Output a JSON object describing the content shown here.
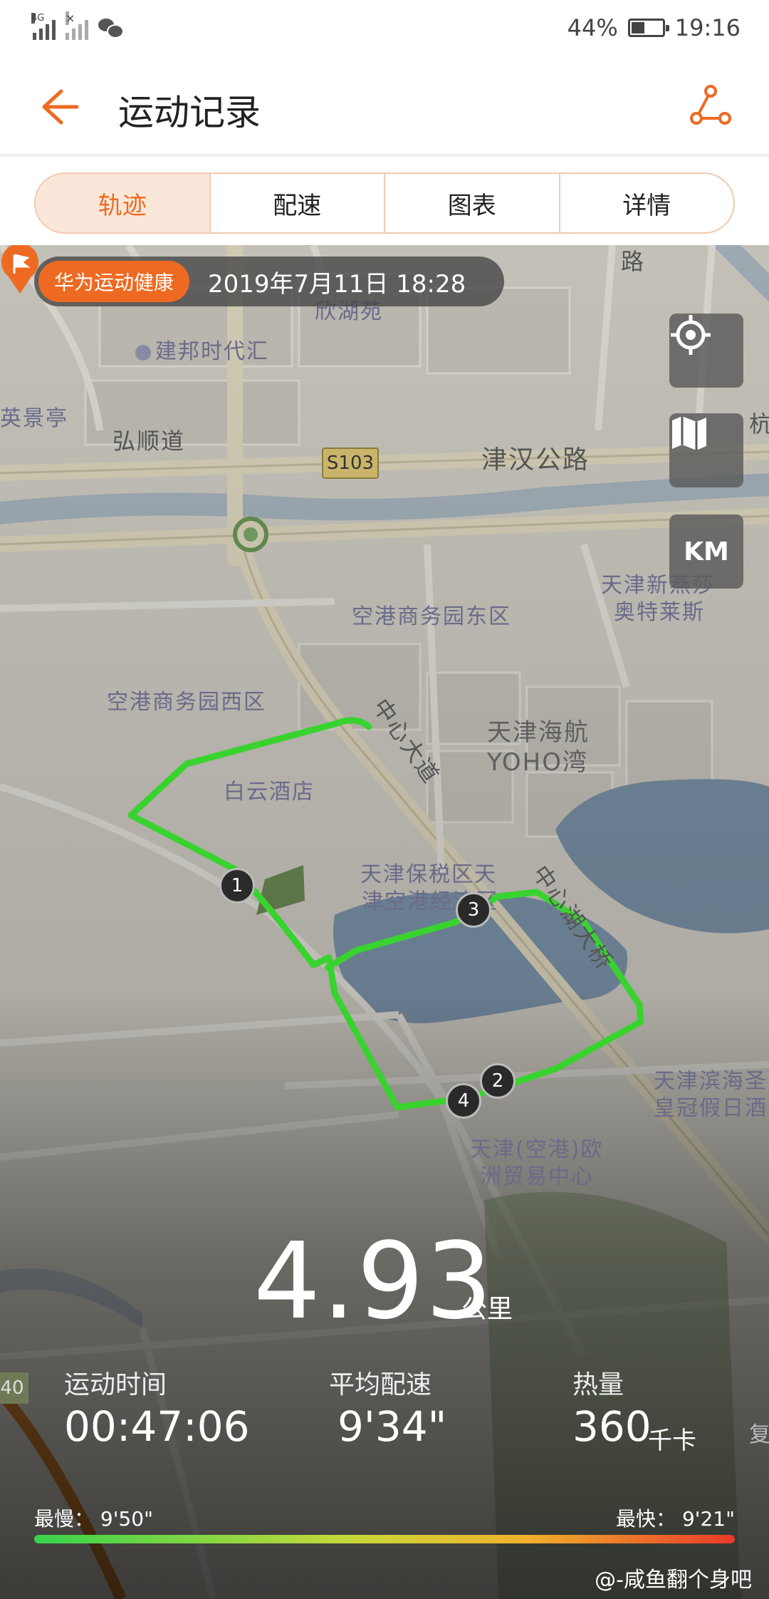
{
  "status_bar": {
    "network": "4G",
    "battery": "44%",
    "battery_level": 0.44,
    "time": "19:16"
  },
  "header": {
    "title": "运动记录",
    "back_icon": "arrow-left-icon",
    "share_icon": "share-icon"
  },
  "tabs": [
    {
      "label": "轨迹",
      "active": true
    },
    {
      "label": "配速",
      "active": false
    },
    {
      "label": "图表",
      "active": false
    },
    {
      "label": "详情",
      "active": false
    }
  ],
  "record": {
    "brand": "华为运动健康",
    "datetime": "2019年7月11日 18:28"
  },
  "map_controls": {
    "locate_icon": "crosshair-icon",
    "layers_icon": "map-icon",
    "unit_label": "KM"
  },
  "map_labels": {
    "road_1": "路",
    "poi_1": "欣湖苑",
    "poi_2": "建邦时代汇",
    "poi_3": "英景亭",
    "road_2": "弘顺道",
    "road_3": "津汉公路",
    "road_4": "杭",
    "highway_badge": "S103",
    "poi_4": "空港商务园东区",
    "poi_5": "天津新燕莎",
    "poi_5b": "奥特莱斯",
    "poi_6": "空港商务园西区",
    "road_5": "中心大道",
    "poi_7": "天津海航",
    "poi_7b": "YOHO湾",
    "poi_8": "白云酒店",
    "poi_9": "天津保税区天",
    "poi_9b": "津空港经济区",
    "road_6": "中心湖大桥",
    "poi_10": "天津滨海圣",
    "poi_10b": "皇冠假日酒",
    "poi_11": "天津(空港)欧",
    "poi_11b": "洲贸易中心",
    "highway_badge_2": "40",
    "poi_12": "复"
  },
  "laps": [
    "1",
    "2",
    "3",
    "4"
  ],
  "summary": {
    "distance": "4.93",
    "distance_unit": "公里",
    "duration_label": "运动时间",
    "duration": "00:47:06",
    "pace_label": "平均配速",
    "pace": "9'34\"",
    "calories_label": "热量",
    "calories": "360",
    "calories_unit": "千卡",
    "slowest_label": "最慢：",
    "slowest": "9'50\"",
    "fastest_label": "最快：",
    "fastest": "9'21\""
  },
  "watermark": "@-咸鱼翻个身吧",
  "colors": {
    "accent": "#ee6a22",
    "track": "#39d32f",
    "tab_active_bg": "#fbe7d9"
  }
}
